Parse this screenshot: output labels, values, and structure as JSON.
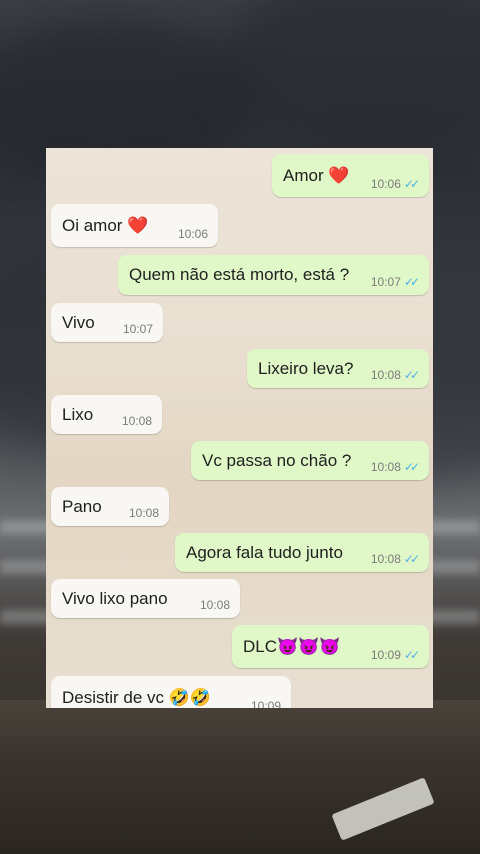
{
  "messages": [
    {
      "dir": "out",
      "text": "Amor ❤️",
      "time": "10:06",
      "ticks": "✓✓"
    },
    {
      "dir": "in",
      "text": "Oi amor ❤️",
      "time": "10:06"
    },
    {
      "dir": "out",
      "text": "Quem não está morto, está ?",
      "time": "10:07",
      "ticks": "✓✓"
    },
    {
      "dir": "in",
      "text": "Vivo",
      "time": "10:07"
    },
    {
      "dir": "out",
      "text": "Lixeiro leva?",
      "time": "10:08",
      "ticks": "✓✓"
    },
    {
      "dir": "in",
      "text": "Lixo",
      "time": "10:08"
    },
    {
      "dir": "out",
      "text": "Vc passa no chão ?",
      "time": "10:08",
      "ticks": "✓✓"
    },
    {
      "dir": "in",
      "text": "Pano",
      "time": "10:08"
    },
    {
      "dir": "out",
      "text": "Agora fala tudo junto",
      "time": "10:08",
      "ticks": "✓✓"
    },
    {
      "dir": "in",
      "text": "Vivo lixo pano",
      "time": "10:08"
    },
    {
      "dir": "out",
      "text": "DLC😈😈😈",
      "time": "10:09",
      "ticks": "✓✓"
    },
    {
      "dir": "in",
      "text": "Desistir de vc 🤣🤣",
      "time": "10:09"
    }
  ],
  "colors": {
    "outgoing_bubble": "#e0f8c8",
    "incoming_bubble": "#f9f7f3",
    "read_ticks": "#4fb0e6"
  }
}
